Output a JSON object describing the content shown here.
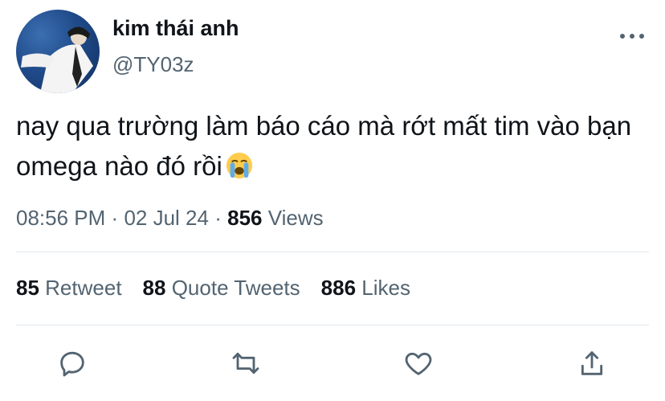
{
  "user": {
    "display_name": "kim thái anh",
    "handle": "@TY03z"
  },
  "tweet": {
    "text": "nay qua trường làm báo cáo mà rớt mất tim vào bạn omega nào đó rồi",
    "emoji": "loudly-crying-face"
  },
  "meta": {
    "time": "08:56 PM",
    "sep1": "·",
    "date": "02 Jul 24",
    "sep2": "·",
    "views_count": "856",
    "views_label": "Views"
  },
  "stats": {
    "retweets_count": "85",
    "retweets_label": "Retweet",
    "quotes_count": "88",
    "quotes_label": "Quote Tweets",
    "likes_count": "886",
    "likes_label": "Likes"
  },
  "actions": [
    "reply-icon",
    "retweet-icon",
    "like-icon",
    "share-icon"
  ],
  "colors": {
    "text": "#0f1419",
    "secondary": "#536471",
    "divider": "#e1e8ed"
  }
}
